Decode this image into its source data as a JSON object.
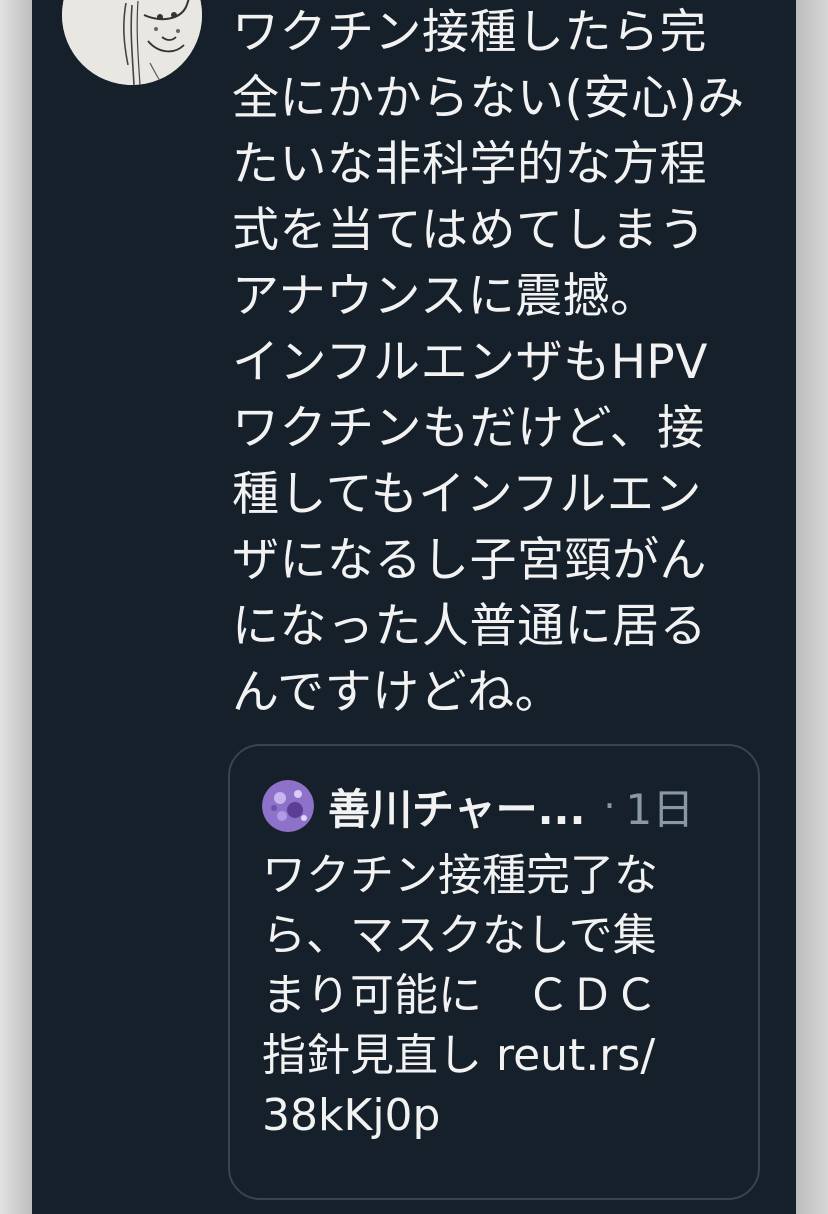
{
  "tweet": {
    "avatar": "user-avatar-sketch",
    "text": "ワクチン接種したら完\n全にかからない(安心)み\nたいな非科学的な方程\n式を当てはめてしまう\nアナウンスに震撼。\nインフルエンザもHPV\nワクチンもだけど、接\n種してもインフルエン\nザになるし子宮頸がん\nになった人普通に居る\nんですけどね。"
  },
  "quote": {
    "avatar": "quoted-user-avatar",
    "name": "善川チャー...",
    "separator": "·",
    "time": "1日",
    "text": "ワクチン接種完了な\nら、マスクなしで集\nまり可能に　ＣＤＣ\n指針見直し reut.rs/\n38kKj0p"
  },
  "colors": {
    "background": "#15202b",
    "text": "#f2f2f2",
    "muted": "#8899a6",
    "border": "#38444d"
  }
}
